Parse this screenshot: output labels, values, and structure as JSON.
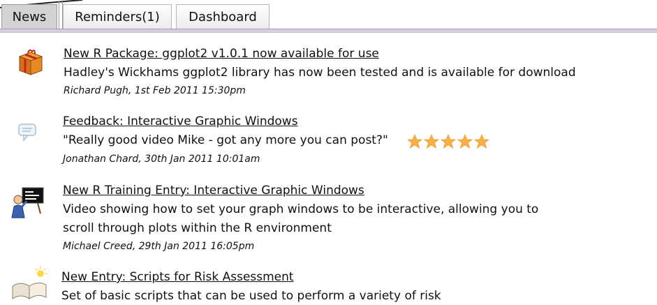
{
  "tabs": [
    {
      "label": "News",
      "active": true
    },
    {
      "label": "Reminders(1)",
      "active": false
    },
    {
      "label": "Dashboard",
      "active": false
    }
  ],
  "colors": {
    "active_tab_bg": "#d3d3d3",
    "tab_rule": "#d8cde3",
    "star": "#f5b04a"
  },
  "news": [
    {
      "icon": "package-icon",
      "title": "New R Package: ggplot2 v1.0.1 now available for use",
      "body": [
        "Hadley's Wickhams ggplot2 library has now been tested and is available for download"
      ],
      "meta": "Richard Pugh, 1st Feb 2011 15:30pm"
    },
    {
      "icon": "comment-icon",
      "title": "Feedback: Interactive Graphic Windows",
      "body": [
        "\"Really good video Mike - got any more you can post?\""
      ],
      "rating": 5,
      "meta": "Jonathan Chard, 30th Jan 2011 10:01am"
    },
    {
      "icon": "training-presenter-icon",
      "title": "New R Training Entry: Interactive Graphic Windows",
      "body": [
        "Video showing how to set your graph windows to be interactive, allowing you to",
        "scroll through plots within the R environment"
      ],
      "meta": "Michael Creed, 29th Jan 2011 16:05pm"
    },
    {
      "icon": "open-book-icon",
      "title": "New Entry: Scripts for Risk Assessment",
      "body": [
        "Set of basic scripts that can be used to perform a variety of risk"
      ]
    }
  ]
}
